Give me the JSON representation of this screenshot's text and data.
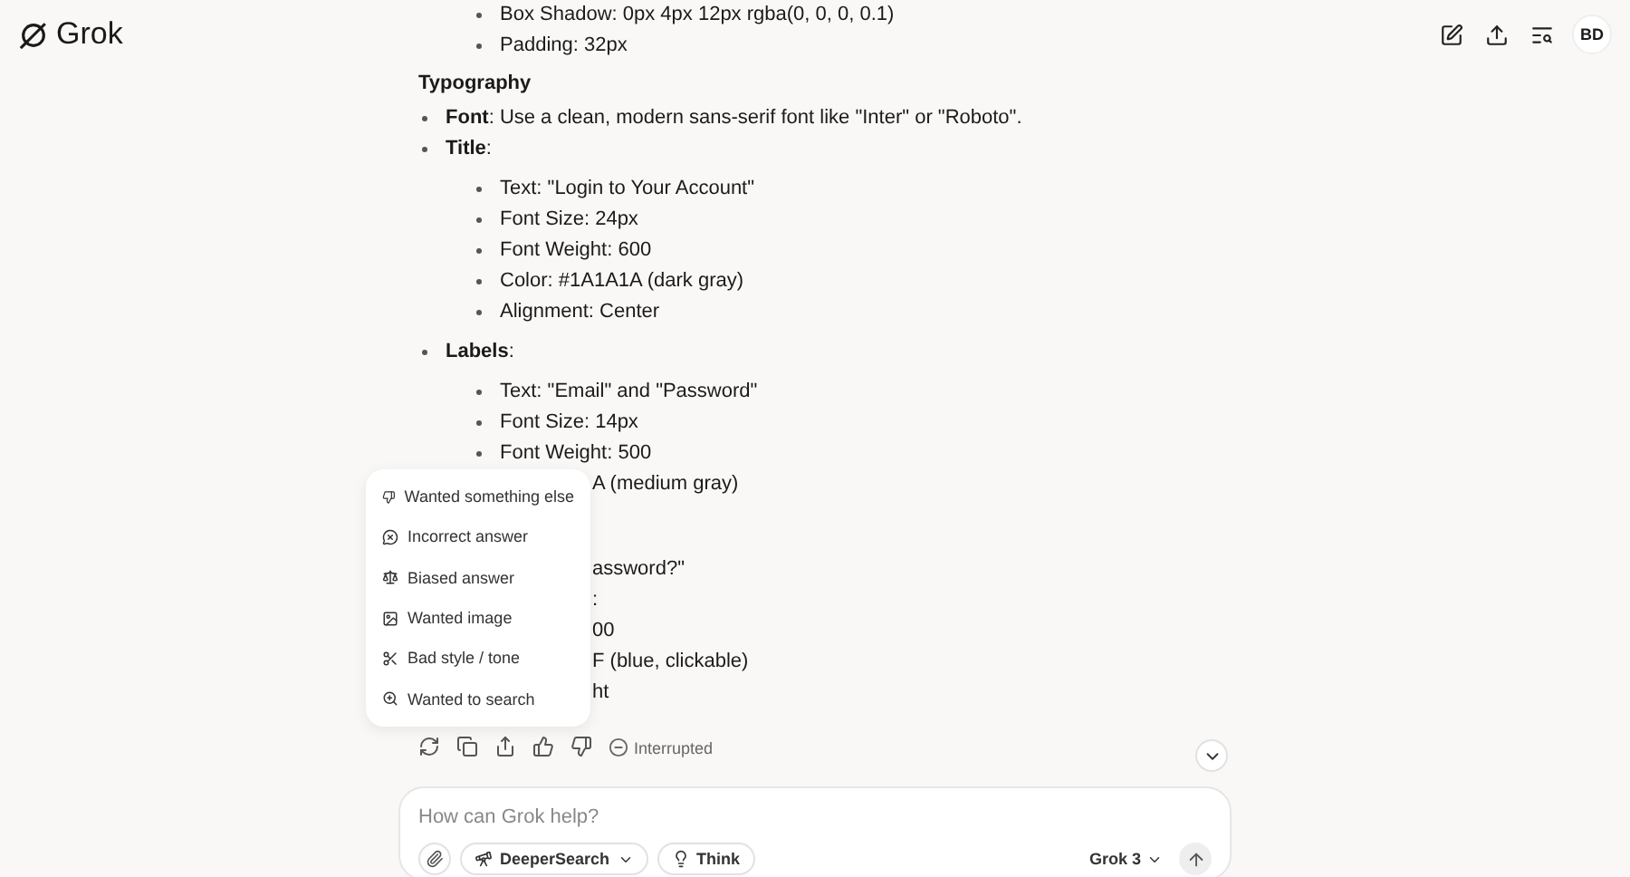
{
  "header": {
    "logo": "Grok",
    "avatar": "BD"
  },
  "message": {
    "top_items": [
      "Box Shadow: 0px 4px 12px rgba(0, 0, 0, 0.1)",
      "Padding: 32px"
    ],
    "heading": "Typography",
    "items": [
      {
        "text": "**Font**: Use a clean, modern sans-serif font like \"Inter\" or \"Roboto\"."
      },
      {
        "text": "**Title**:",
        "children": [
          "Text: \"Login to Your Account\"",
          "Font Size: 24px",
          "Font Weight: 600",
          "Color: #1A1A1A (dark gray)",
          "Alignment: Center"
        ]
      },
      {
        "text": "**Labels**:",
        "children": [
          "Text: \"Email\" and \"Password\"",
          "Font Size: 14px",
          "Font Weight: 500"
        ]
      }
    ],
    "fragment_groups": [
      [
        "A (medium gray)"
      ],
      [
        "assword?\"",
        ":",
        "00",
        "F (blue, clickable)",
        "ht"
      ]
    ],
    "status": "Interrupted"
  },
  "feedback_menu": [
    "Wanted something else",
    "Incorrect answer",
    "Biased answer",
    "Wanted image",
    "Bad style / tone",
    "Wanted to search"
  ],
  "composer": {
    "placeholder": "How can Grok help?",
    "tools": [
      {
        "label": "DeeperSearch",
        "kind": "dropdown"
      },
      {
        "label": "Think",
        "kind": "toggle"
      }
    ],
    "model": "Grok 3"
  }
}
